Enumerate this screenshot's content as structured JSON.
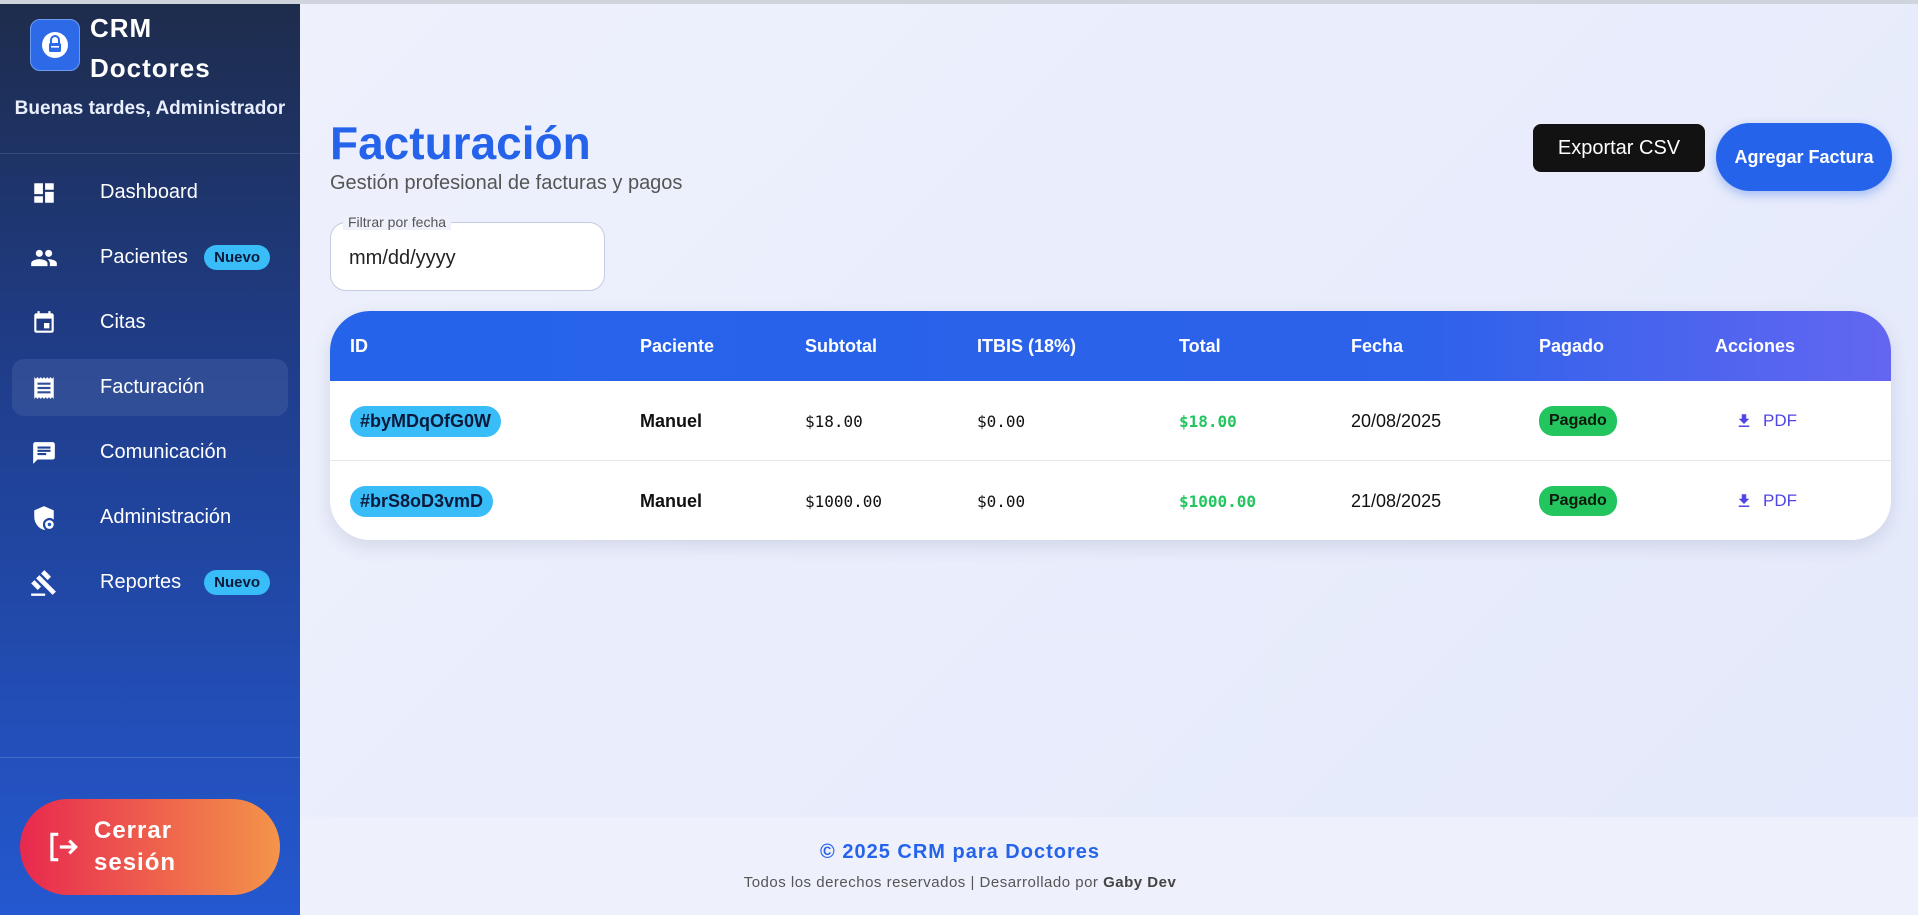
{
  "brand": {
    "name": "CRM Doctores",
    "greeting": "Buenas tardes, Administrador"
  },
  "sidebar": {
    "items": [
      {
        "label": "Dashboard",
        "icon": "dashboard-icon"
      },
      {
        "label": "Pacientes",
        "icon": "people-icon",
        "badge": "Nuevo"
      },
      {
        "label": "Citas",
        "icon": "calendar-icon"
      },
      {
        "label": "Facturación",
        "icon": "receipt-icon",
        "active": true
      },
      {
        "label": "Comunicación",
        "icon": "chat-icon"
      },
      {
        "label": "Administración",
        "icon": "admin-shield-icon"
      },
      {
        "label": "Reportes",
        "icon": "gavel-icon",
        "badge": "Nuevo"
      }
    ],
    "logout_label": "Cerrar sesión"
  },
  "header": {
    "title": "Facturación",
    "subtitle": "Gestión profesional de facturas y pagos",
    "export_label": "Exportar CSV",
    "add_label": "Agregar Factura"
  },
  "filter": {
    "label": "Filtrar por fecha",
    "placeholder": "mm/dd/yyyy"
  },
  "table": {
    "columns": [
      "ID",
      "Paciente",
      "Subtotal",
      "ITBIS (18%)",
      "Total",
      "Fecha",
      "Pagado",
      "Acciones"
    ],
    "rows": [
      {
        "id": "#byMDqOfG0W",
        "paciente": "Manuel",
        "subtotal": "$18.00",
        "itbis": "$0.00",
        "total": "$18.00",
        "fecha": "20/08/2025",
        "pagado": "Pagado",
        "accion": "PDF"
      },
      {
        "id": "#brS8oD3vmD",
        "paciente": "Manuel",
        "subtotal": "$1000.00",
        "itbis": "$0.00",
        "total": "$1000.00",
        "fecha": "21/08/2025",
        "pagado": "Pagado",
        "accion": "PDF"
      }
    ]
  },
  "footer": {
    "copyright": "© 2025 CRM para Doctores",
    "rights": "Todos los derechos reservados | Desarrollado por",
    "author": "Gaby Dev"
  },
  "colors": {
    "accent": "#2563eb",
    "badge": "#38bdf8",
    "success": "#22c55e",
    "logout_from": "#e8294f",
    "logout_to": "#f4944a"
  }
}
